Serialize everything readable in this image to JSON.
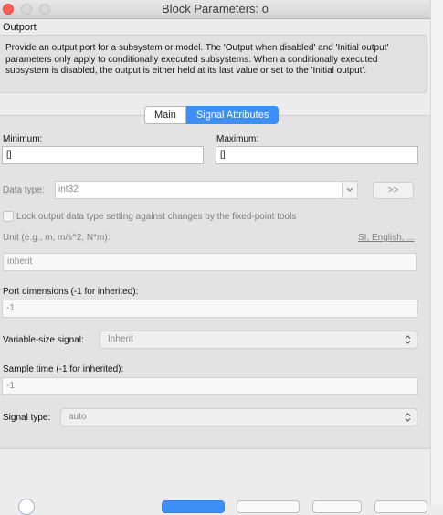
{
  "window": {
    "title": "Block Parameters: o"
  },
  "block": {
    "name": "Outport"
  },
  "description": "Provide an output port for a subsystem or model.  The 'Output when disabled' and 'Initial output' parameters only apply to conditionally executed subsystems. When a conditionally executed subsystem is disabled, the output is either held at its last value or set to the 'Initial output'.",
  "tabs": [
    {
      "label": "Main",
      "selected": false
    },
    {
      "label": "Signal Attributes",
      "selected": true
    }
  ],
  "signal_attributes": {
    "minimum_label": "Minimum:",
    "minimum_value": "[]",
    "maximum_label": "Maximum:",
    "maximum_value": "[]",
    "data_type_label": "Data type:",
    "data_type_value": "int32",
    "assistant_button": ">>",
    "lock_label": "Lock output data type setting against changes by the fixed-point tools",
    "lock_checked": false,
    "unit_label": "Unit (e.g., m, m/s^2, N*m):",
    "unit_link": "SI, English, ...",
    "unit_value": "inherit",
    "port_dimensions_label": "Port dimensions (-1 for inherited):",
    "port_dimensions_value": "-1",
    "variable_size_label": "Variable-size signal:",
    "variable_size_value": "Inherit",
    "sample_time_label": "Sample time (-1 for inherited):",
    "sample_time_value": "-1",
    "signal_type_label": "Signal type:",
    "signal_type_value": "auto"
  },
  "colors": {
    "accent": "#3d8ff6",
    "close": "#fc5f57"
  },
  "icons": [
    "close-light-icon",
    "minimize-light-icon",
    "zoom-light-icon",
    "updown-arrow-icon",
    "chevron-down-icon",
    "help-icon"
  ]
}
